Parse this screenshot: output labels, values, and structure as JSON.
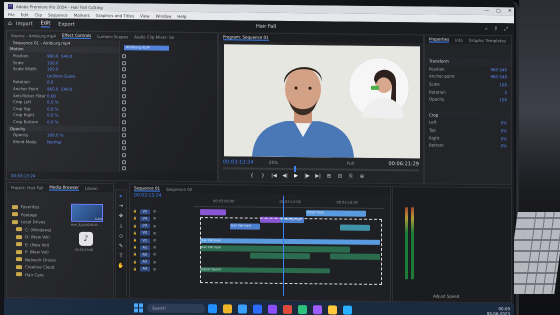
{
  "window": {
    "title": "Adobe Premiere Pro 2024 - Hair Fall Cutting",
    "controls": [
      "—",
      "▢",
      "✕"
    ]
  },
  "menu": [
    "File",
    "Edit",
    "Clip",
    "Sequence",
    "Markers",
    "Graphics and Titles",
    "View",
    "Window",
    "Help"
  ],
  "workspace": {
    "tabs": [
      "Import",
      "Edit",
      "Export"
    ],
    "active": "Edit",
    "project_title": "Hair Fall",
    "right_icons": [
      "⌕",
      "⇪",
      "⤢"
    ]
  },
  "effect_controls": {
    "tabs": [
      "Effect Controls",
      "Lumetri Scopes",
      "Audio Clip Mixer: Se"
    ],
    "source_line": "Source - Ambiurg.mp4",
    "sequence_line": "Sequence 01 - Ambiurg.mp4",
    "clip_label": "Ambiurg.mp4",
    "clip_time": "00:00:13:00",
    "rows": [
      {
        "label": "Motion",
        "type": "head"
      },
      {
        "label": "Position",
        "v1": "960.0",
        "v2": "540.0"
      },
      {
        "label": "Scale",
        "v1": "100.0",
        "v2": ""
      },
      {
        "label": "Scale Width",
        "v1": "100.0",
        "v2": ""
      },
      {
        "label": "",
        "v1": "Uniform Scale",
        "v2": ""
      },
      {
        "label": "Rotation",
        "v1": "0.0",
        "v2": ""
      },
      {
        "label": "Anchor Point",
        "v1": "960.0",
        "v2": "540.0"
      },
      {
        "label": "Anti-flicker Filter",
        "v1": "0.00",
        "v2": ""
      },
      {
        "label": "Crop Left",
        "v1": "0.0 %",
        "v2": ""
      },
      {
        "label": "Crop Top",
        "v1": "0.0 %",
        "v2": ""
      },
      {
        "label": "Crop Right",
        "v1": "0.0 %",
        "v2": ""
      },
      {
        "label": "Crop Bottom",
        "v1": "0.0 %",
        "v2": ""
      },
      {
        "label": "Opacity",
        "type": "head"
      },
      {
        "label": "Opacity",
        "v1": "100.0 %",
        "v2": ""
      },
      {
        "label": "Blend Mode",
        "v1": "Normal",
        "v2": ""
      }
    ],
    "timecode": "00:03:13:24"
  },
  "program_monitor": {
    "tab": "Program: Sequence 01",
    "timecode_left": "00:03:13:24",
    "timecode_right": "00:06:21:29",
    "fit": "25%",
    "quality": "Full",
    "transport": [
      "{",
      "}",
      "|◀",
      "◀|",
      "▶",
      "|▶",
      "▶|",
      "⊞",
      "⊟",
      "⎘",
      "⊕"
    ]
  },
  "properties": {
    "tabs": [
      "Properties",
      "Info",
      "Graphic Templates"
    ],
    "sections": [
      {
        "title": "Transform",
        "rows": [
          {
            "label": "Position",
            "value": "960 540"
          },
          {
            "label": "Anchor point",
            "value": "960 540"
          },
          {
            "label": "Scale",
            "value": "100"
          },
          {
            "label": "Rotation",
            "value": "0"
          },
          {
            "label": "Opacity",
            "value": "100"
          }
        ]
      },
      {
        "title": "Crop",
        "rows": [
          {
            "label": "Left",
            "value": "0%"
          },
          {
            "label": "Top",
            "value": "0%"
          },
          {
            "label": "Right",
            "value": "0%"
          },
          {
            "label": "Bottom",
            "value": "0%"
          }
        ]
      }
    ]
  },
  "project": {
    "tabs": [
      "Project: Hair Fall",
      "Media Browser",
      "Librari"
    ],
    "items": [
      "Favorites",
      "Footage",
      "Local Drives",
      "C: (Windows)",
      "D: (New Vol)",
      "E: (New Vol)",
      "F: (New Vol)",
      "Network Drives",
      "Creative Cloud",
      "Hair Care"
    ]
  },
  "media_browser": {
    "thumb1_label": "Hair_B_b2d2d1d7...",
    "thumb1_duration": "1:24",
    "thumb2_label": "00:03:13:00"
  },
  "tools": [
    "▸",
    "⇥",
    "✥",
    "⟂",
    "◇",
    "✎",
    "T",
    "✋"
  ],
  "timeline": {
    "tabs": [
      "Sequence 01",
      "Sequence 02"
    ],
    "timecode": "00:03:13:24",
    "ruler": [
      "00:03:06:00",
      "00:03:12:00",
      "00:03:18:00"
    ],
    "tracks": [
      "V5",
      "V4",
      "V3",
      "V2",
      "V1",
      "A1",
      "A2",
      "A3",
      "A4"
    ],
    "clips": [
      {
        "label": "Video Track",
        "track": 0
      },
      {
        "label": "Ambiurg.mp4",
        "track": 1
      },
      {
        "label": "Hair Fall.mp4",
        "track": 2
      },
      {
        "label": "Hair Fall.mp4",
        "track": 4
      },
      {
        "label": "Hair Fall.mp4",
        "track": 5
      },
      {
        "label": "Adjust Speed",
        "track": 8
      }
    ]
  },
  "taskbar": {
    "search_placeholder": "Search",
    "time": "00:09",
    "date": "08-06-2023",
    "icon_colors": [
      "#1e90ff",
      "#f0b429",
      "#3aa0ff",
      "#2b6cff",
      "#8a4dff",
      "#e04a3a",
      "#2ec27e",
      "#9e5bff",
      "#ffc83d",
      "#27b0ff"
    ]
  },
  "status": {
    "adjust_speed": "Adjust Speed"
  }
}
